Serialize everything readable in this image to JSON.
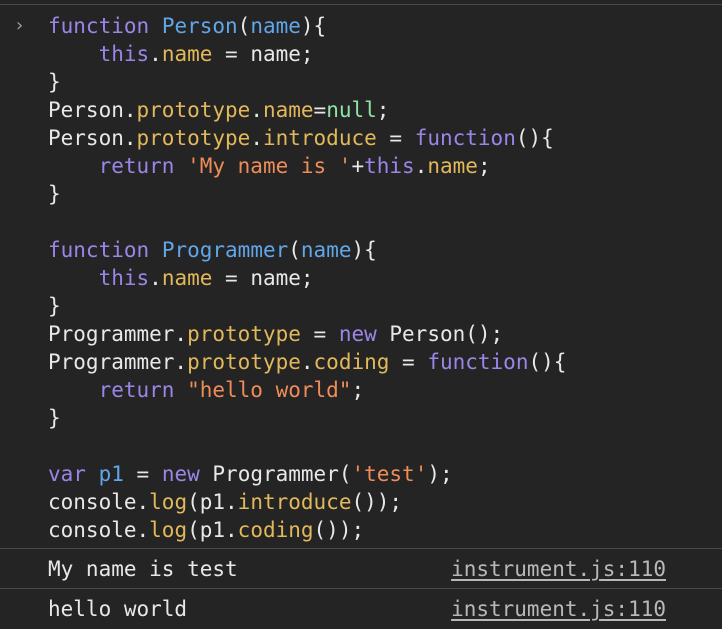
{
  "console": {
    "prompt_glyph": "›",
    "code_lines": [
      [
        {
          "t": "kw",
          "v": "function"
        },
        {
          "t": "pl",
          "v": " "
        },
        {
          "t": "fn",
          "v": "Person"
        },
        {
          "t": "pl",
          "v": "("
        },
        {
          "t": "fn",
          "v": "name"
        },
        {
          "t": "pl",
          "v": "){"
        }
      ],
      [
        {
          "t": "pl",
          "v": "    "
        },
        {
          "t": "kw",
          "v": "this"
        },
        {
          "t": "pl",
          "v": "."
        },
        {
          "t": "prop",
          "v": "name"
        },
        {
          "t": "pl",
          "v": " = name;"
        }
      ],
      [
        {
          "t": "pl",
          "v": "}"
        }
      ],
      [
        {
          "t": "pl",
          "v": "Person."
        },
        {
          "t": "prop",
          "v": "prototype"
        },
        {
          "t": "pl",
          "v": "."
        },
        {
          "t": "prop",
          "v": "name"
        },
        {
          "t": "pl",
          "v": "="
        },
        {
          "t": "lit",
          "v": "null"
        },
        {
          "t": "pl",
          "v": ";"
        }
      ],
      [
        {
          "t": "pl",
          "v": "Person."
        },
        {
          "t": "prop",
          "v": "prototype"
        },
        {
          "t": "pl",
          "v": "."
        },
        {
          "t": "prop",
          "v": "introduce"
        },
        {
          "t": "pl",
          "v": " = "
        },
        {
          "t": "kw",
          "v": "function"
        },
        {
          "t": "pl",
          "v": "(){"
        }
      ],
      [
        {
          "t": "pl",
          "v": "    "
        },
        {
          "t": "kw",
          "v": "return"
        },
        {
          "t": "pl",
          "v": " "
        },
        {
          "t": "str",
          "v": "'My name is '"
        },
        {
          "t": "pl",
          "v": "+"
        },
        {
          "t": "kw",
          "v": "this"
        },
        {
          "t": "pl",
          "v": "."
        },
        {
          "t": "prop",
          "v": "name"
        },
        {
          "t": "pl",
          "v": ";"
        }
      ],
      [
        {
          "t": "pl",
          "v": "}"
        }
      ],
      [],
      [
        {
          "t": "kw",
          "v": "function"
        },
        {
          "t": "pl",
          "v": " "
        },
        {
          "t": "fn",
          "v": "Programmer"
        },
        {
          "t": "pl",
          "v": "("
        },
        {
          "t": "fn",
          "v": "name"
        },
        {
          "t": "pl",
          "v": "){"
        }
      ],
      [
        {
          "t": "pl",
          "v": "    "
        },
        {
          "t": "kw",
          "v": "this"
        },
        {
          "t": "pl",
          "v": "."
        },
        {
          "t": "prop",
          "v": "name"
        },
        {
          "t": "pl",
          "v": " = name;"
        }
      ],
      [
        {
          "t": "pl",
          "v": "}"
        }
      ],
      [
        {
          "t": "pl",
          "v": "Programmer."
        },
        {
          "t": "prop",
          "v": "prototype"
        },
        {
          "t": "pl",
          "v": " = "
        },
        {
          "t": "kw",
          "v": "new"
        },
        {
          "t": "pl",
          "v": " Person();"
        }
      ],
      [
        {
          "t": "pl",
          "v": "Programmer."
        },
        {
          "t": "prop",
          "v": "prototype"
        },
        {
          "t": "pl",
          "v": "."
        },
        {
          "t": "prop",
          "v": "coding"
        },
        {
          "t": "pl",
          "v": " = "
        },
        {
          "t": "kw",
          "v": "function"
        },
        {
          "t": "pl",
          "v": "(){"
        }
      ],
      [
        {
          "t": "pl",
          "v": "    "
        },
        {
          "t": "kw",
          "v": "return"
        },
        {
          "t": "pl",
          "v": " "
        },
        {
          "t": "str",
          "v": "\"hello world\""
        },
        {
          "t": "pl",
          "v": ";"
        }
      ],
      [
        {
          "t": "pl",
          "v": "}"
        }
      ],
      [],
      [
        {
          "t": "kw",
          "v": "var"
        },
        {
          "t": "pl",
          "v": " "
        },
        {
          "t": "fn",
          "v": "p1"
        },
        {
          "t": "pl",
          "v": " = "
        },
        {
          "t": "kw",
          "v": "new"
        },
        {
          "t": "pl",
          "v": " Programmer("
        },
        {
          "t": "str",
          "v": "'test'"
        },
        {
          "t": "pl",
          "v": ");"
        }
      ],
      [
        {
          "t": "pl",
          "v": "console."
        },
        {
          "t": "prop",
          "v": "log"
        },
        {
          "t": "pl",
          "v": "(p1."
        },
        {
          "t": "prop",
          "v": "introduce"
        },
        {
          "t": "pl",
          "v": "());"
        }
      ],
      [
        {
          "t": "pl",
          "v": "console."
        },
        {
          "t": "prop",
          "v": "log"
        },
        {
          "t": "pl",
          "v": "(p1."
        },
        {
          "t": "prop",
          "v": "coding"
        },
        {
          "t": "pl",
          "v": "());"
        }
      ]
    ],
    "outputs": [
      {
        "text": "My name is test",
        "source": "instrument.js:110"
      },
      {
        "text": "hello world",
        "source": "instrument.js:110"
      }
    ]
  },
  "colors": {
    "background": "#242424",
    "keyword": "#9b86e8",
    "identifier": "#61a6e8",
    "property": "#e2b85a",
    "string": "#f08c5a",
    "literal": "#8fe3a3",
    "plain": "#e8e8e8",
    "divider": "#4a4a4a"
  }
}
